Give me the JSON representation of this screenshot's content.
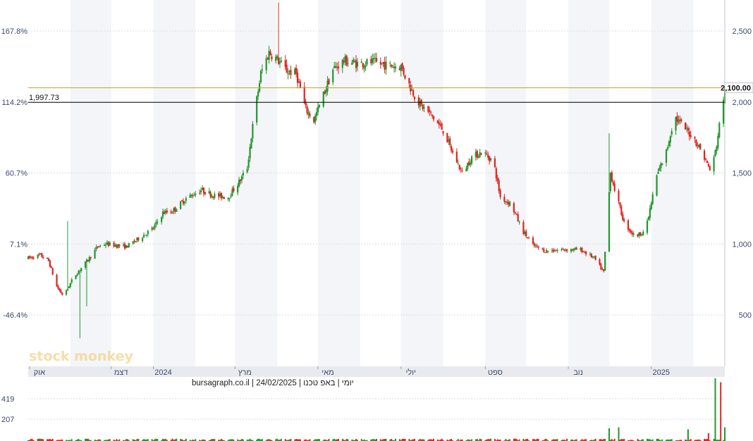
{
  "chart_data": {
    "type": "candlestick",
    "title": "",
    "caption": "יומי | באפ טכנו | 24/02/2025 | bursagraph.co.il",
    "watermark": "stock monkey",
    "x_axis": {
      "labels": [
        "אוק",
        "דצמ",
        "2024",
        "מרץ",
        "מאי",
        "יולי",
        "ספט",
        "נוב",
        "2025"
      ],
      "range": [
        "2023-10-01",
        "2025-02-24"
      ]
    },
    "y_axis_price": {
      "ticks": [
        "500",
        "1,000",
        "1,500",
        "2,000",
        "2,500"
      ],
      "values": [
        500,
        1000,
        1500,
        2000,
        2500
      ],
      "range": [
        335,
        2700
      ]
    },
    "y_axis_percent": {
      "ticks": [
        "-46.4%",
        "7.1%",
        "60.7%",
        "114.2%",
        "167.8%"
      ]
    },
    "reference_lines": [
      {
        "label": "1,997.73",
        "value": 1997.73,
        "color": "#000000"
      },
      {
        "label": "2,100.00",
        "value": 2100,
        "color": "#c8a028"
      }
    ],
    "volume_axis": {
      "ticks": [
        "207",
        "419"
      ],
      "values": [
        207,
        419
      ],
      "max": 640
    },
    "series": [
      {
        "path_points": [
          [
            "2023-10-01",
            900
          ],
          [
            "2023-10-10",
            920
          ],
          [
            "2023-10-16",
            880
          ],
          [
            "2023-10-22",
            700
          ],
          [
            "2023-10-27",
            630
          ],
          [
            "2023-11-03",
            760
          ],
          [
            "2023-11-08",
            820
          ],
          [
            "2023-11-15",
            900
          ],
          [
            "2023-11-21",
            980
          ],
          [
            "2023-11-27",
            1000
          ],
          [
            "2023-12-05",
            990
          ],
          [
            "2023-12-12",
            980
          ],
          [
            "2023-12-20",
            1030
          ],
          [
            "2024-01-01",
            1110
          ],
          [
            "2024-01-08",
            1220
          ],
          [
            "2024-01-15",
            1230
          ],
          [
            "2024-01-25",
            1320
          ],
          [
            "2024-02-05",
            1380
          ],
          [
            "2024-02-15",
            1340
          ],
          [
            "2024-02-25",
            1330
          ],
          [
            "2024-03-05",
            1450
          ],
          [
            "2024-03-10",
            1540
          ],
          [
            "2024-03-15",
            1900
          ],
          [
            "2024-03-20",
            2200
          ],
          [
            "2024-03-26",
            2350
          ],
          [
            "2024-04-01",
            2300
          ],
          [
            "2024-04-08",
            2220
          ],
          [
            "2024-04-15",
            2200
          ],
          [
            "2024-04-22",
            1950
          ],
          [
            "2024-04-28",
            1870
          ],
          [
            "2024-05-05",
            2050
          ],
          [
            "2024-05-12",
            2230
          ],
          [
            "2024-05-20",
            2290
          ],
          [
            "2024-05-30",
            2270
          ],
          [
            "2024-06-10",
            2280
          ],
          [
            "2024-06-20",
            2260
          ],
          [
            "2024-07-01",
            2250
          ],
          [
            "2024-07-08",
            2100
          ],
          [
            "2024-07-15",
            1980
          ],
          [
            "2024-07-22",
            1920
          ],
          [
            "2024-08-01",
            1800
          ],
          [
            "2024-08-08",
            1640
          ],
          [
            "2024-08-15",
            1500
          ],
          [
            "2024-08-22",
            1610
          ],
          [
            "2024-08-30",
            1650
          ],
          [
            "2024-09-07",
            1580
          ],
          [
            "2024-09-12",
            1330
          ],
          [
            "2024-09-20",
            1280
          ],
          [
            "2024-09-28",
            1100
          ],
          [
            "2024-10-06",
            990
          ],
          [
            "2024-10-15",
            950
          ],
          [
            "2024-10-28",
            960
          ],
          [
            "2024-11-10",
            960
          ],
          [
            "2024-11-20",
            900
          ],
          [
            "2024-11-27",
            800
          ],
          [
            "2024-12-02",
            1500
          ],
          [
            "2024-12-06",
            1350
          ],
          [
            "2024-12-12",
            1150
          ],
          [
            "2024-12-20",
            1050
          ],
          [
            "2024-12-28",
            1100
          ],
          [
            "2025-01-05",
            1480
          ],
          [
            "2025-01-12",
            1650
          ],
          [
            "2025-01-18",
            1900
          ],
          [
            "2025-01-24",
            1830
          ],
          [
            "2025-02-01",
            1750
          ],
          [
            "2025-02-07",
            1650
          ],
          [
            "2025-02-14",
            1500
          ],
          [
            "2025-02-18",
            1700
          ],
          [
            "2025-02-21",
            1900
          ],
          [
            "2025-02-24",
            2100
          ]
        ]
      }
    ],
    "volume_spikes": [
      {
        "date": "2024-12-01",
        "value": 130
      },
      {
        "date": "2024-12-08",
        "value": 140
      },
      {
        "date": "2025-01-28",
        "value": 120
      },
      {
        "date": "2025-02-12",
        "value": 80
      },
      {
        "date": "2025-02-17",
        "value": 640
      },
      {
        "date": "2025-02-21",
        "value": 600
      },
      {
        "date": "2025-02-24",
        "value": 140
      }
    ],
    "colors": {
      "up": "#23962e",
      "down": "#e0231e",
      "band": "#f3f5f8",
      "grid": "#d8dce4"
    }
  }
}
